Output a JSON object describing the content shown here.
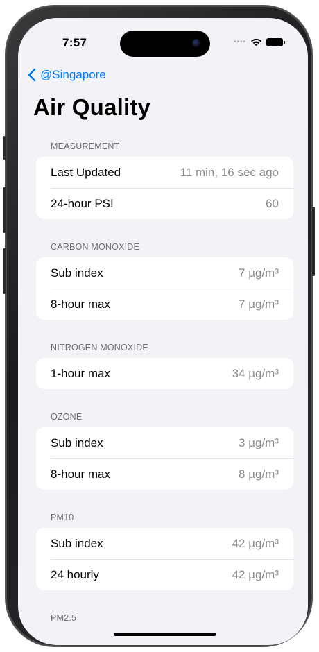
{
  "status_bar": {
    "time": "7:57",
    "icons": [
      "signal-dots-icon",
      "wifi-icon",
      "battery-icon"
    ]
  },
  "nav": {
    "back_label": "@Singapore",
    "back_icon": "chevron-left-icon",
    "accent_color": "#007aff"
  },
  "page": {
    "title": "Air Quality"
  },
  "sections": [
    {
      "header": "MEASUREMENT",
      "rows": [
        {
          "label": "Last Updated",
          "value": "11 min, 16 sec ago"
        },
        {
          "label": "24-hour PSI",
          "value": "60"
        }
      ]
    },
    {
      "header": "CARBON MONOXIDE",
      "rows": [
        {
          "label": "Sub index",
          "value": "7 µg/m³"
        },
        {
          "label": "8-hour max",
          "value": "7 µg/m³"
        }
      ]
    },
    {
      "header": "NITROGEN MONOXIDE",
      "rows": [
        {
          "label": "1-hour max",
          "value": "34 µg/m³"
        }
      ]
    },
    {
      "header": "OZONE",
      "rows": [
        {
          "label": "Sub index",
          "value": "3 µg/m³"
        },
        {
          "label": "8-hour max",
          "value": "8 µg/m³"
        }
      ]
    },
    {
      "header": "PM10",
      "rows": [
        {
          "label": "Sub index",
          "value": "42 µg/m³"
        },
        {
          "label": "24 hourly",
          "value": "42 µg/m³"
        }
      ]
    },
    {
      "header": "PM2.5",
      "rows": []
    }
  ]
}
